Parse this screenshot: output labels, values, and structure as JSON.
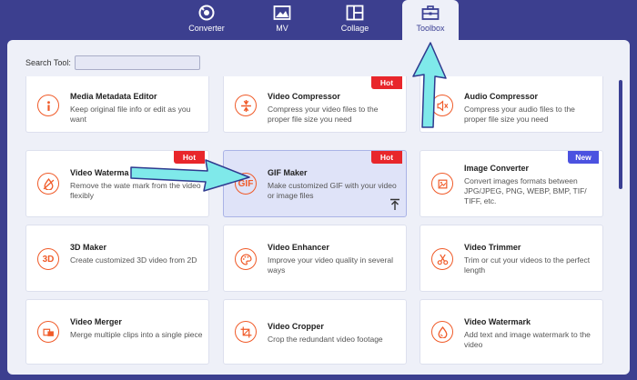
{
  "nav": {
    "tabs": [
      {
        "label": "Converter",
        "icon": "converter-icon"
      },
      {
        "label": "MV",
        "icon": "mv-icon"
      },
      {
        "label": "Collage",
        "icon": "collage-icon"
      },
      {
        "label": "Toolbox",
        "icon": "toolbox-icon",
        "active": true
      }
    ]
  },
  "search": {
    "label": "Search Tool:",
    "value": ""
  },
  "tools": [
    {
      "title": "Media Metadata Editor",
      "desc": "Keep original file info or edit as you want",
      "icon": "info-icon",
      "badge": ""
    },
    {
      "title": "Video Compressor",
      "desc": "Compress your video files to the proper file size you need",
      "icon": "compress-icon",
      "badge": "Hot"
    },
    {
      "title": "Audio Compressor",
      "desc": "Compress your audio files to the proper file size you need",
      "icon": "audio-compress-icon",
      "badge": ""
    },
    {
      "title": "Video Waterma",
      "desc": "Remove the wate mark from the video flexibly",
      "icon": "watermark-remove-icon",
      "badge": "Hot"
    },
    {
      "title": "GIF Maker",
      "desc": "Make customized GIF with your video or image files",
      "icon": "gif-icon",
      "icon_text": "GIF",
      "badge": "Hot",
      "selected": true
    },
    {
      "title": "Image Converter",
      "desc": "Convert images formats between JPG/JPEG, PNG, WEBP, BMP, TIF/ TIFF, etc.",
      "icon": "image-converter-icon",
      "badge": "New"
    },
    {
      "title": "3D Maker",
      "desc": "Create customized 3D video from 2D",
      "icon": "3d-icon",
      "icon_text": "3D",
      "badge": ""
    },
    {
      "title": "Video Enhancer",
      "desc": "Improve your video quality in several ways",
      "icon": "palette-icon",
      "badge": ""
    },
    {
      "title": "Video Trimmer",
      "desc": "Trim or cut your videos to the perfect length",
      "icon": "scissors-icon",
      "badge": ""
    },
    {
      "title": "Video Merger",
      "desc": "Merge multiple clips into a single piece",
      "icon": "merge-icon",
      "badge": ""
    },
    {
      "title": "Video Cropper",
      "desc": "Crop the redundant video footage",
      "icon": "crop-icon",
      "badge": ""
    },
    {
      "title": "Video Watermark",
      "desc": "Add text and image watermark to the video",
      "icon": "watermark-icon",
      "badge": ""
    }
  ],
  "colors": {
    "background": "#3c3f8f",
    "panel": "#eef0f8",
    "accent": "#f05a28",
    "hot_badge": "#e8262b",
    "new_badge": "#4b52e0",
    "annotation_arrow": "#7fe9ea"
  }
}
